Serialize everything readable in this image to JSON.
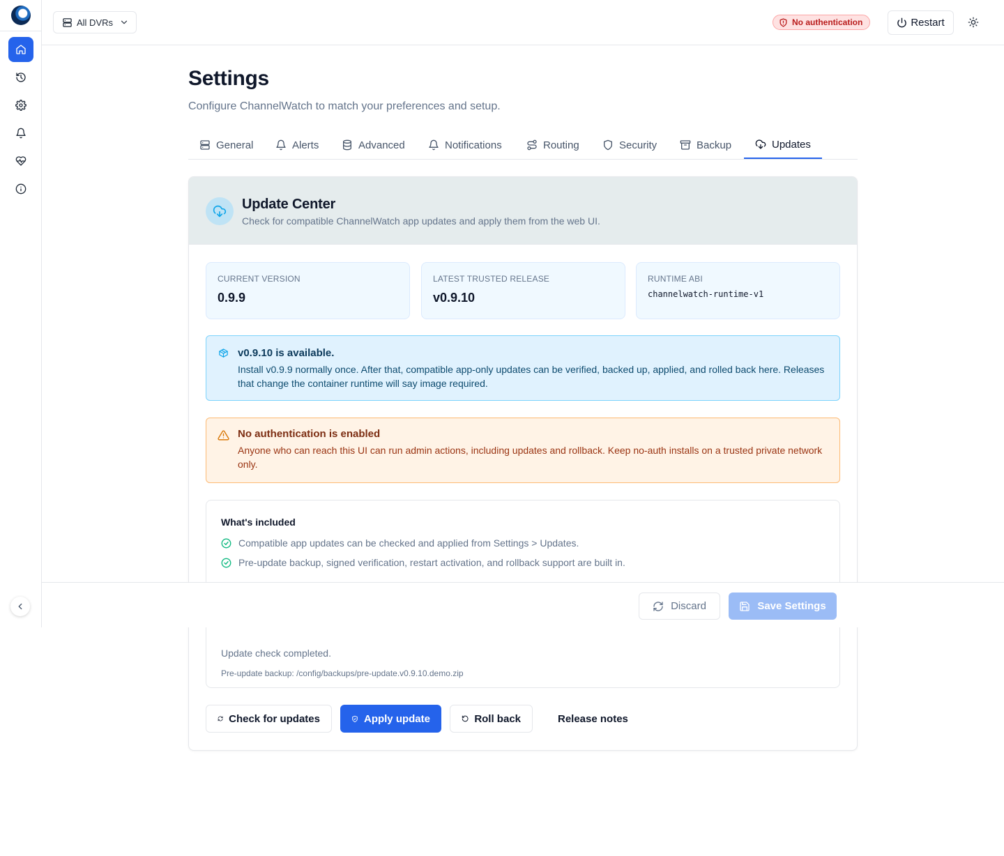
{
  "topbar": {
    "dvr_select": "All DVRs",
    "auth_badge": "No authentication",
    "restart_label": "Restart"
  },
  "page": {
    "title": "Settings",
    "subtitle": "Configure ChannelWatch to match your preferences and setup."
  },
  "tabs": [
    {
      "label": "General",
      "icon": "server-icon"
    },
    {
      "label": "Alerts",
      "icon": "bell-icon"
    },
    {
      "label": "Advanced",
      "icon": "database-icon"
    },
    {
      "label": "Notifications",
      "icon": "bell-icon"
    },
    {
      "label": "Routing",
      "icon": "route-icon"
    },
    {
      "label": "Security",
      "icon": "shield-icon"
    },
    {
      "label": "Backup",
      "icon": "archive-icon"
    },
    {
      "label": "Updates",
      "icon": "cloud-download-icon",
      "active": true
    }
  ],
  "update_center": {
    "title": "Update Center",
    "subtitle": "Check for compatible ChannelWatch app updates and apply them from the web UI.",
    "current_version_label": "CURRENT VERSION",
    "current_version": "0.9.9",
    "latest_label": "LATEST TRUSTED RELEASE",
    "latest_version": "v0.9.10",
    "runtime_label": "RUNTIME ABI",
    "runtime_value": "channelwatch-runtime-v1",
    "available_title": "v0.9.10 is available.",
    "available_text": "Install v0.9.9 normally once. After that, compatible app-only updates can be verified, backed up, applied, and rolled back here. Releases that change the container runtime will say image required.",
    "warn_title": "No authentication is enabled",
    "warn_text": "Anyone who can reach this UI can run admin actions, including updates and rollback. Keep no-auth installs on a trusted private network only.",
    "included_title": "What's included",
    "included_items": [
      "Compatible app updates can be checked and applied from Settings > Updates.",
      "Pre-update backup, signed verification, restart activation, and rollback support are built in."
    ],
    "status_message": "Update check completed.",
    "status_backup": "Pre-update backup: /config/backups/pre-update.v0.9.10.demo.zip",
    "actions": {
      "check": "Check for updates",
      "apply": "Apply update",
      "rollback": "Roll back",
      "notes": "Release notes"
    }
  },
  "savebar": {
    "discard": "Discard",
    "save": "Save Settings"
  },
  "colors": {
    "accent": "#2563eb",
    "info_bg": "#e0f2fe",
    "warn_bg": "#fff3e6",
    "danger": "#b91c1c"
  }
}
